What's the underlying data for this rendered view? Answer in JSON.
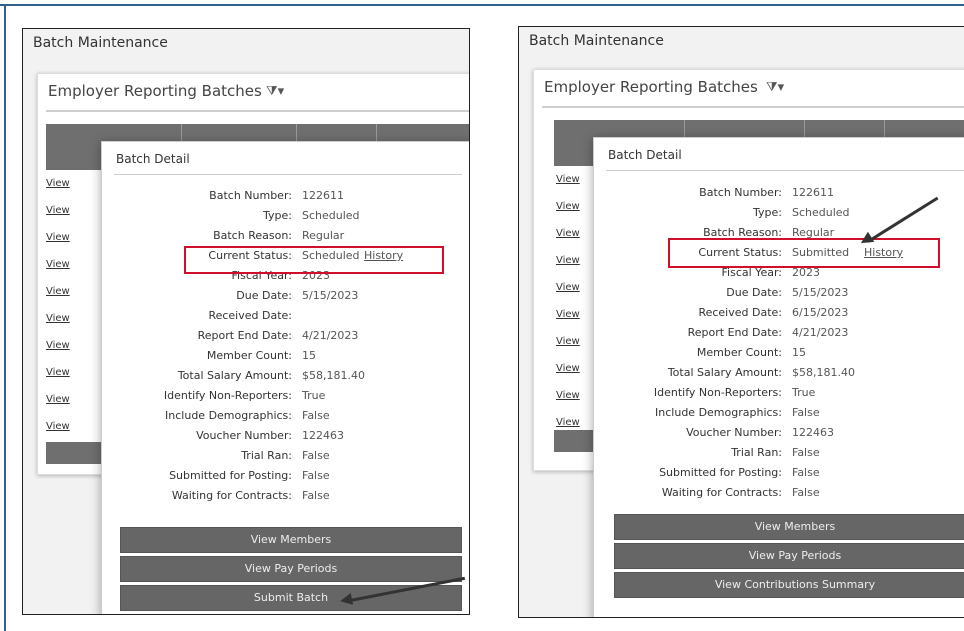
{
  "left": {
    "breadcrumb": "Batch Maintenance",
    "grid_title": "Employer Reporting Batches",
    "row_link": "View",
    "detail_title": "Batch Detail",
    "fields": [
      {
        "label": "Batch Number:",
        "value": "122611"
      },
      {
        "label": "Type:",
        "value": "Scheduled"
      },
      {
        "label": "Batch Reason:",
        "value": "Regular"
      },
      {
        "label": "Current Status:",
        "value": "Scheduled",
        "link": "History"
      },
      {
        "label": "Fiscal Year:",
        "value": "2023"
      },
      {
        "label": "Due Date:",
        "value": "5/15/2023"
      },
      {
        "label": "Received Date:",
        "value": ""
      },
      {
        "label": "Report End Date:",
        "value": "4/21/2023"
      },
      {
        "label": "Member Count:",
        "value": "15"
      },
      {
        "label": "Total Salary Amount:",
        "value": "$58,181.40"
      },
      {
        "label": "Identify Non-Reporters:",
        "value": "True"
      },
      {
        "label": "Include Demographics:",
        "value": "False"
      },
      {
        "label": "Voucher Number:",
        "value": "122463"
      },
      {
        "label": "Trial Ran:",
        "value": "False"
      },
      {
        "label": "Submitted for Posting:",
        "value": "False"
      },
      {
        "label": "Waiting for Contracts:",
        "value": "False"
      }
    ],
    "buttons": [
      "View Members",
      "View Pay Periods",
      "Submit Batch"
    ]
  },
  "right": {
    "breadcrumb": "Batch Maintenance",
    "grid_title": "Employer Reporting Batches",
    "row_link": "View",
    "detail_title": "Batch Detail",
    "fields": [
      {
        "label": "Batch Number:",
        "value": "122611"
      },
      {
        "label": "Type:",
        "value": "Scheduled"
      },
      {
        "label": "Batch Reason:",
        "value": "Regular"
      },
      {
        "label": "Current Status:",
        "value": "Submitted",
        "link": "History"
      },
      {
        "label": "Fiscal Year:",
        "value": "2023"
      },
      {
        "label": "Due Date:",
        "value": "5/15/2023"
      },
      {
        "label": "Received Date:",
        "value": "6/15/2023"
      },
      {
        "label": "Report End Date:",
        "value": "4/21/2023"
      },
      {
        "label": "Member Count:",
        "value": "15"
      },
      {
        "label": "Total Salary Amount:",
        "value": "$58,181.40"
      },
      {
        "label": "Identify Non-Reporters:",
        "value": "True"
      },
      {
        "label": "Include Demographics:",
        "value": "False"
      },
      {
        "label": "Voucher Number:",
        "value": "122463"
      },
      {
        "label": "Trial Ran:",
        "value": "False"
      },
      {
        "label": "Submitted for Posting:",
        "value": "False"
      },
      {
        "label": "Waiting for Contracts:",
        "value": "False"
      }
    ],
    "buttons": [
      "View Members",
      "View Pay Periods",
      "View Contributions Summary"
    ]
  },
  "colors": {
    "highlight": "#d0102a",
    "button": "#666666",
    "grid_header": "#6f6f6f"
  },
  "icons": {
    "filter": "filter-dropdown-icon",
    "arrow": "annotation-arrow"
  }
}
